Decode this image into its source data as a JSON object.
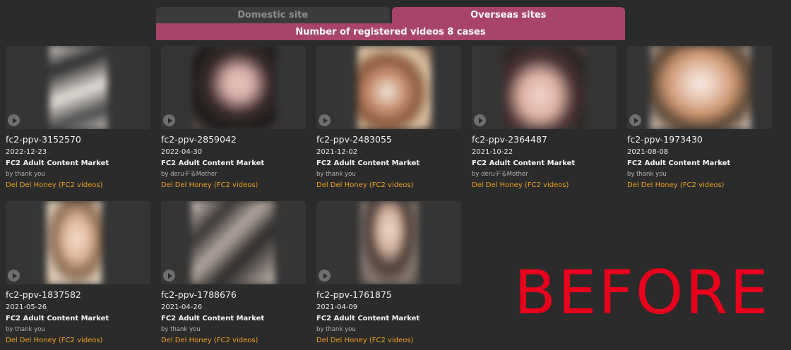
{
  "tabs": [
    {
      "label": "Domestic site",
      "active": false
    },
    {
      "label": "Overseas sites",
      "active": true
    }
  ],
  "count_text": "Number of registered videos 8 cases",
  "colors": {
    "accent": "#a8436a",
    "source_link": "#f0a020",
    "watermark": "#e8001c"
  },
  "videos": [
    {
      "title": "fc2-ppv-3152570",
      "date": "2022-12-23",
      "market": "FC2 Adult Content Market",
      "by": "by thank you",
      "source": "Del Del Honey (FC2 videos)"
    },
    {
      "title": "fc2-ppv-2859042",
      "date": "2022-04-30",
      "market": "FC2 Adult Content Market",
      "by": "by deruデるMother",
      "source": "Del Del Honey (FC2 videos)"
    },
    {
      "title": "fc2-ppv-2483055",
      "date": "2021-12-02",
      "market": "FC2 Adult Content Market",
      "by": "by thank you",
      "source": "Del Del Honey (FC2 videos)"
    },
    {
      "title": "fc2-ppv-2364487",
      "date": "2021-10-22",
      "market": "FC2 Adult Content Market",
      "by": "by deruデるMother",
      "source": "Del Del Honey (FC2 videos)"
    },
    {
      "title": "fc2-ppv-1973430",
      "date": "2021-08-08",
      "market": "FC2 Adult Content Market",
      "by": "by thank you",
      "source": "Del Del Honey (FC2 videos)"
    },
    {
      "title": "fc2-ppv-1837582",
      "date": "2021-05-26",
      "market": "FC2 Adult Content Market",
      "by": "by thank you",
      "source": "Del Del Honey (FC2 videos)"
    },
    {
      "title": "fc2-ppv-1788676",
      "date": "2021-04-26",
      "market": "FC2 Adult Content Market",
      "by": "by thank you",
      "source": "Del Del Honey (FC2 videos)"
    },
    {
      "title": "fc2-ppv-1761875",
      "date": "2021-04-09",
      "market": "FC2 Adult Content Market",
      "by": "by thank you",
      "source": "Del Del Honey (FC2 videos)"
    }
  ],
  "watermark_text": "BEFORE",
  "icons": {
    "play": "play-icon"
  }
}
